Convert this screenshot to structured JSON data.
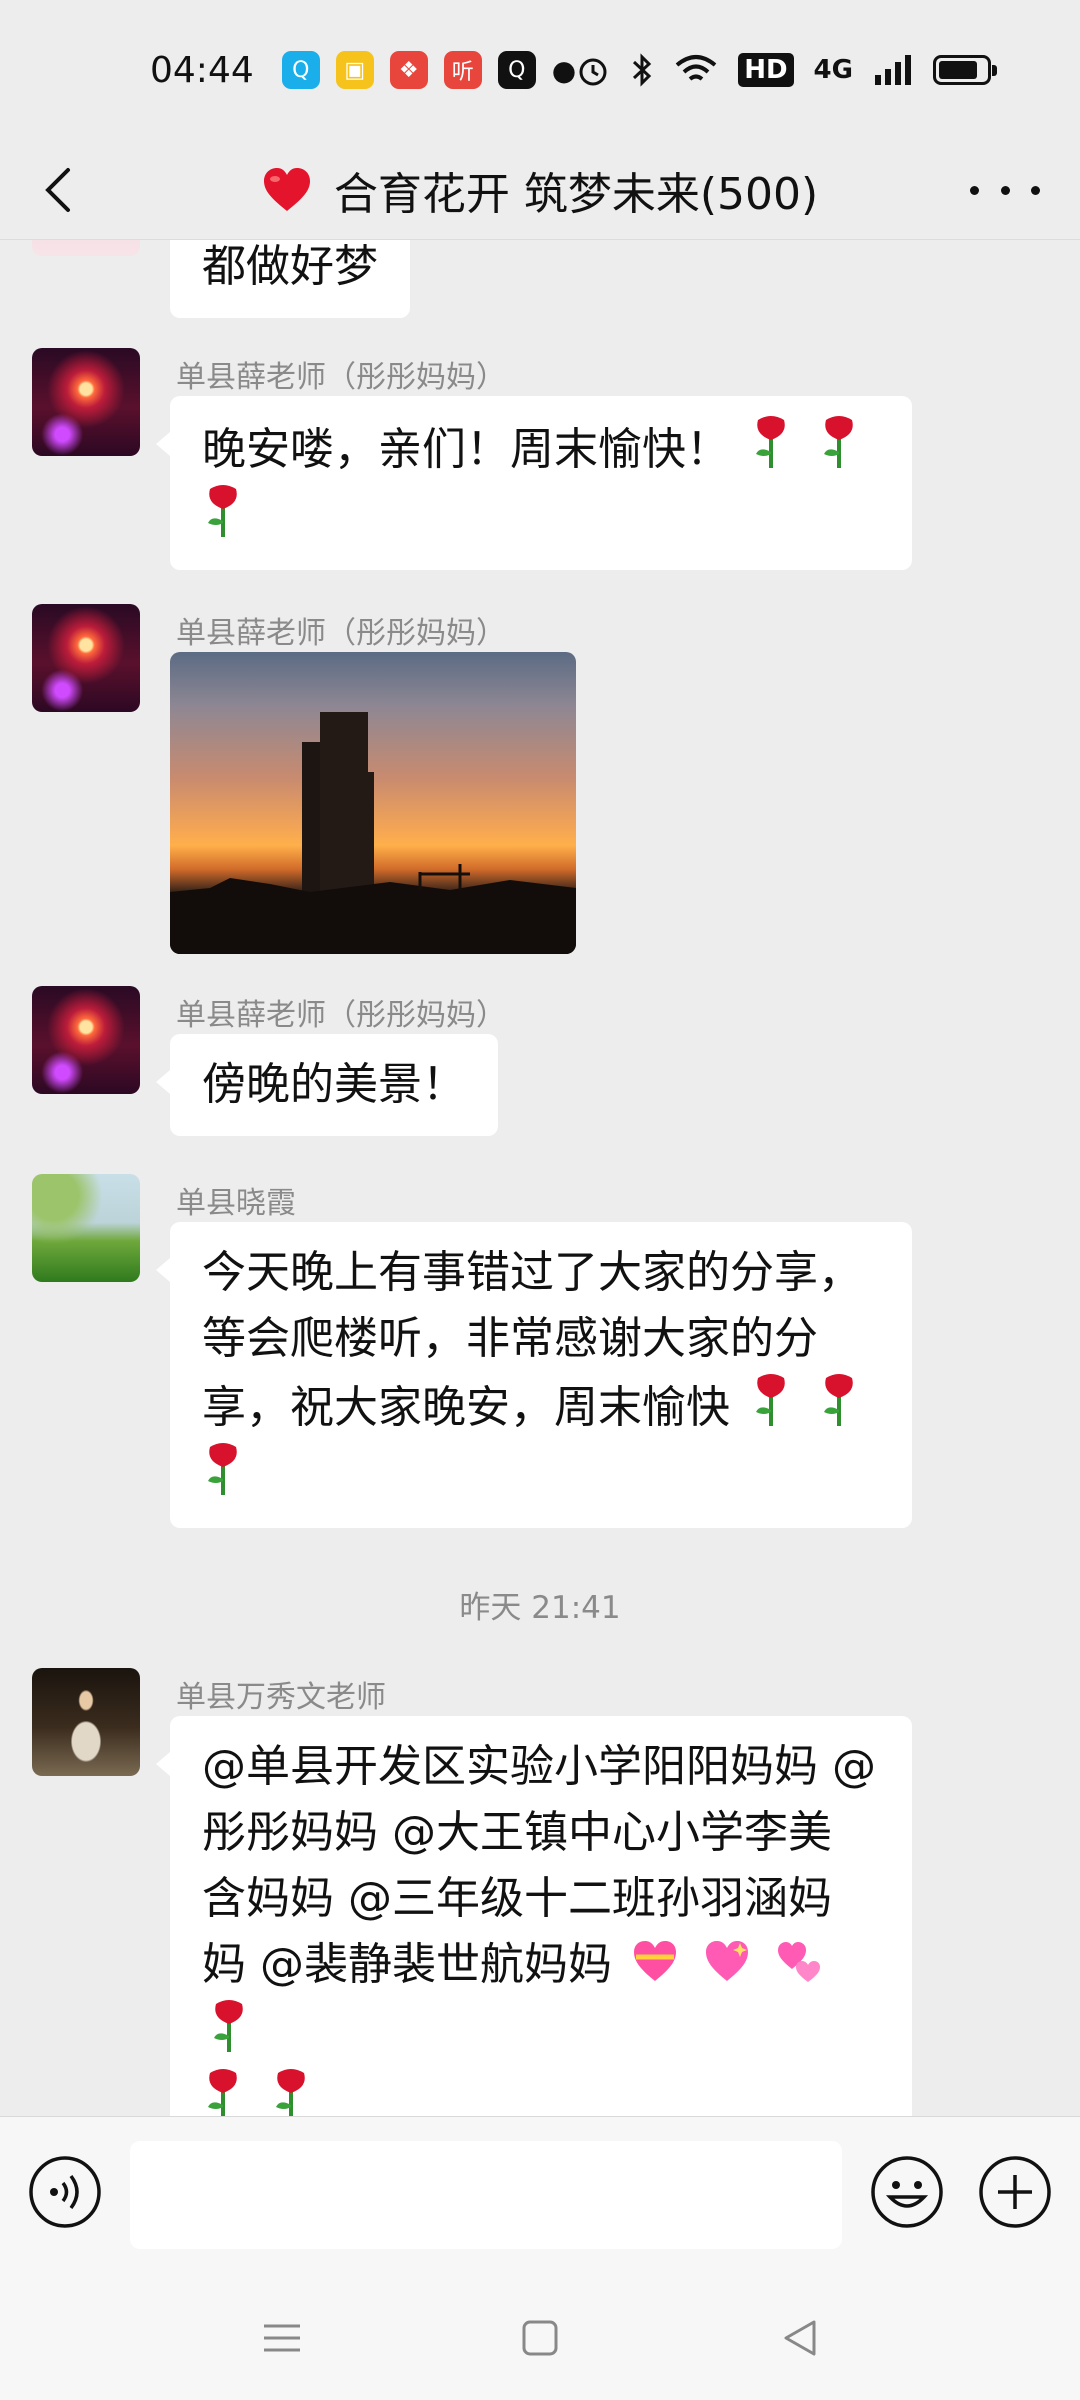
{
  "status_bar": {
    "time": "04:44",
    "notifications": [
      {
        "icon": "qq-icon",
        "color": "#1aaeea",
        "glyph": "Q"
      },
      {
        "icon": "notes-icon",
        "color": "#f6c21c",
        "glyph": "▣"
      },
      {
        "icon": "app-red-icon",
        "color": "#e8453c",
        "glyph": "❖"
      },
      {
        "icon": "listen-app-icon",
        "color": "#e8453c",
        "glyph": "听"
      },
      {
        "icon": "search-q-icon",
        "color": "#111111",
        "glyph": "Q"
      }
    ],
    "hd_label": "HD",
    "network_label": "4G"
  },
  "header": {
    "title": "合育花开 筑梦未来(500)"
  },
  "messages": [
    {
      "sender": "",
      "text": "都做好梦",
      "avatar": "partial"
    },
    {
      "sender": "单县薛老师（彤彤妈妈）",
      "text": "晚安喽，亲们！周末愉快！",
      "avatar": "firework"
    },
    {
      "sender": "单县薛老师（彤彤妈妈）",
      "type": "image",
      "avatar": "firework"
    },
    {
      "sender": "单县薛老师（彤彤妈妈）",
      "text": "傍晚的美景！",
      "avatar": "firework"
    },
    {
      "sender": "单县晓霞",
      "lines": [
        "今天晚上有事错过了大家的分享，",
        "等会爬楼听，非常感谢大家的分",
        "享，祝大家晚安，周末愉快"
      ],
      "avatar": "grass"
    },
    {
      "sender": "单县万秀文老师",
      "lines": [
        "@单县开发区实验小学阳阳妈妈 @",
        "彤彤妈妈  @大王镇中心小学李美",
        "含妈妈  @三年级十二班孙羽涵妈",
        "妈  @裴静裴世航妈妈"
      ],
      "avatar": "person"
    }
  ],
  "timestamp": "昨天 21:41",
  "input": {
    "placeholder": ""
  },
  "colors": {
    "background": "#ededed",
    "bubble": "#ffffff",
    "meta_text": "#8a8a8a"
  }
}
